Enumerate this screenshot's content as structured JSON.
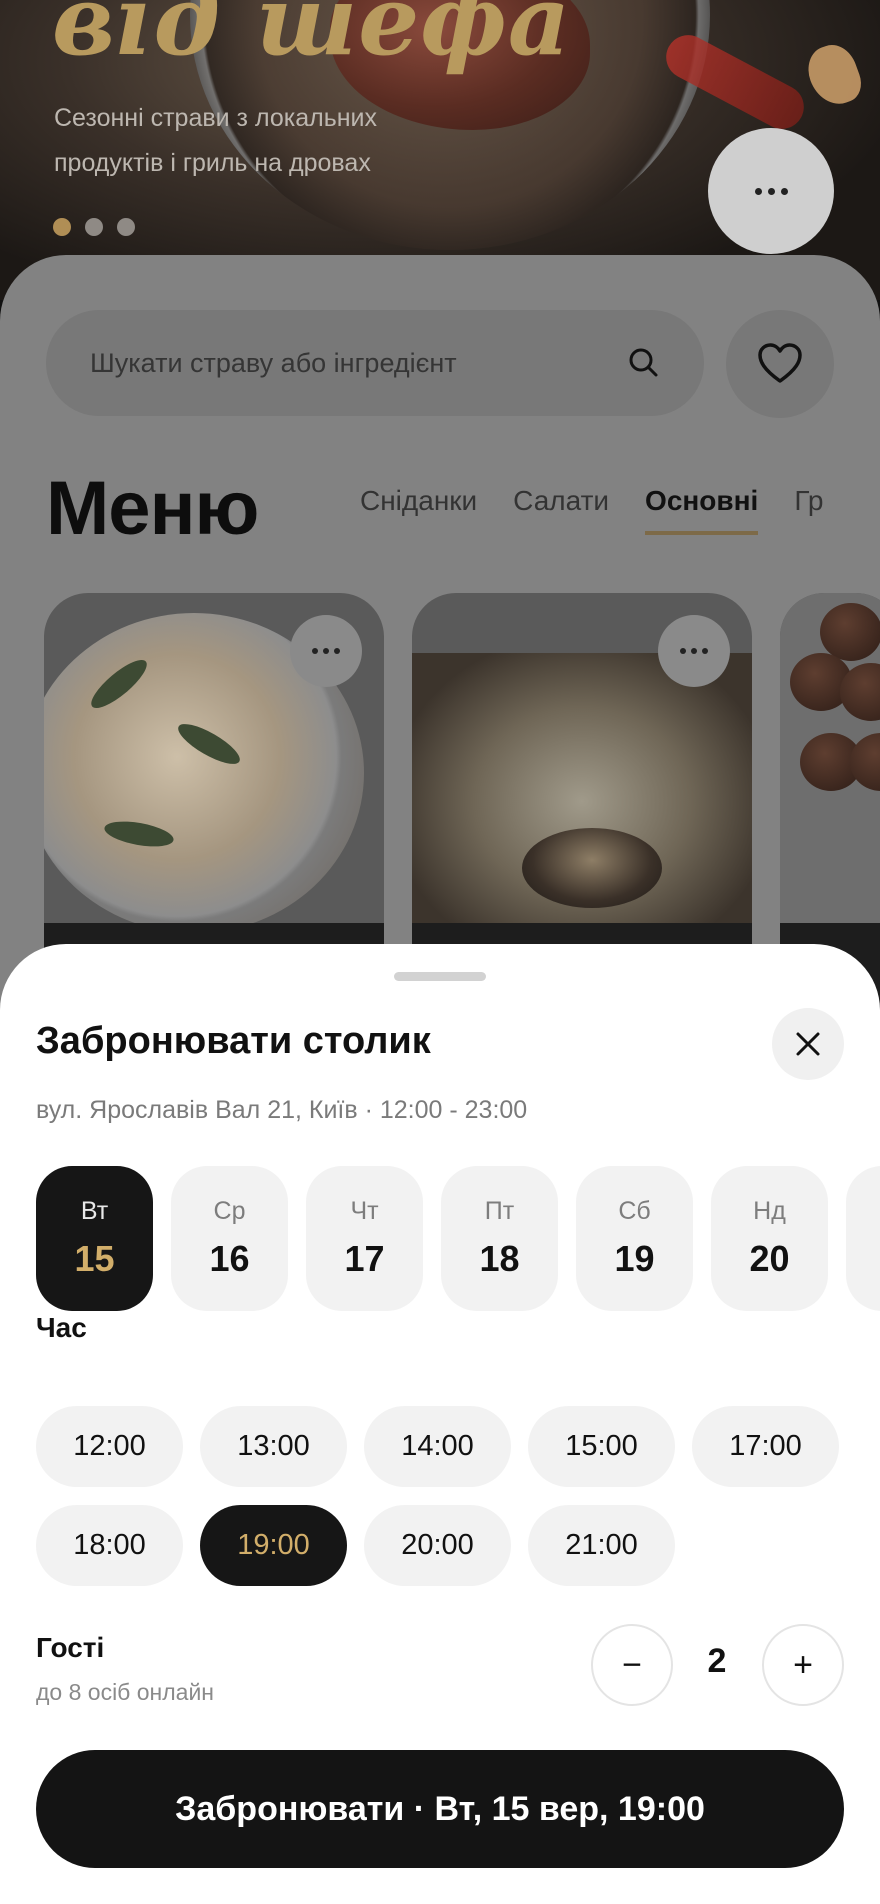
{
  "hero": {
    "title": "від шефа",
    "subtitle": "Сезонні страви з локальних продуктів і гриль на дровах",
    "dots_count": 3,
    "active_dot": 0,
    "more_icon": "more-horizontal-icon"
  },
  "search": {
    "placeholder": "Шукати страву або інгредієнт",
    "icon": "search-icon",
    "favorite_icon": "heart-icon"
  },
  "menu": {
    "title": "Меню",
    "tabs": [
      {
        "label": "Сніданки",
        "active": false
      },
      {
        "label": "Салати",
        "active": false
      },
      {
        "label": "Основні",
        "active": true
      },
      {
        "label": "Гр",
        "active": false
      }
    ]
  },
  "booking": {
    "title": "Забронювати столик",
    "subtitle": "вул. Ярославів Вал 21, Київ · 12:00 - 23:00",
    "days": [
      {
        "dow": "Вт",
        "num": "15",
        "selected": true
      },
      {
        "dow": "Ср",
        "num": "16",
        "selected": false
      },
      {
        "dow": "Чт",
        "num": "17",
        "selected": false
      },
      {
        "dow": "Пт",
        "num": "18",
        "selected": false
      },
      {
        "dow": "Сб",
        "num": "19",
        "selected": false
      },
      {
        "dow": "Нд",
        "num": "20",
        "selected": false
      }
    ],
    "time_label": "Час",
    "times": [
      "12:00",
      "13:00",
      "14:00",
      "15:00",
      "17:00",
      "18:00",
      "19:00",
      "20:00",
      "21:00"
    ],
    "selected_time": "19:00",
    "guests_label": "Гості",
    "guests_sub": "до 8 осіб онлайн",
    "guests_value": "2",
    "minus": "−",
    "plus": "+",
    "submit_label": "Забронювати · Вт, 15 вер, 19:00"
  },
  "colors": {
    "accent_gold": "#d2ae6a",
    "dark": "#141414",
    "chip_bg": "#f2f2f2"
  }
}
